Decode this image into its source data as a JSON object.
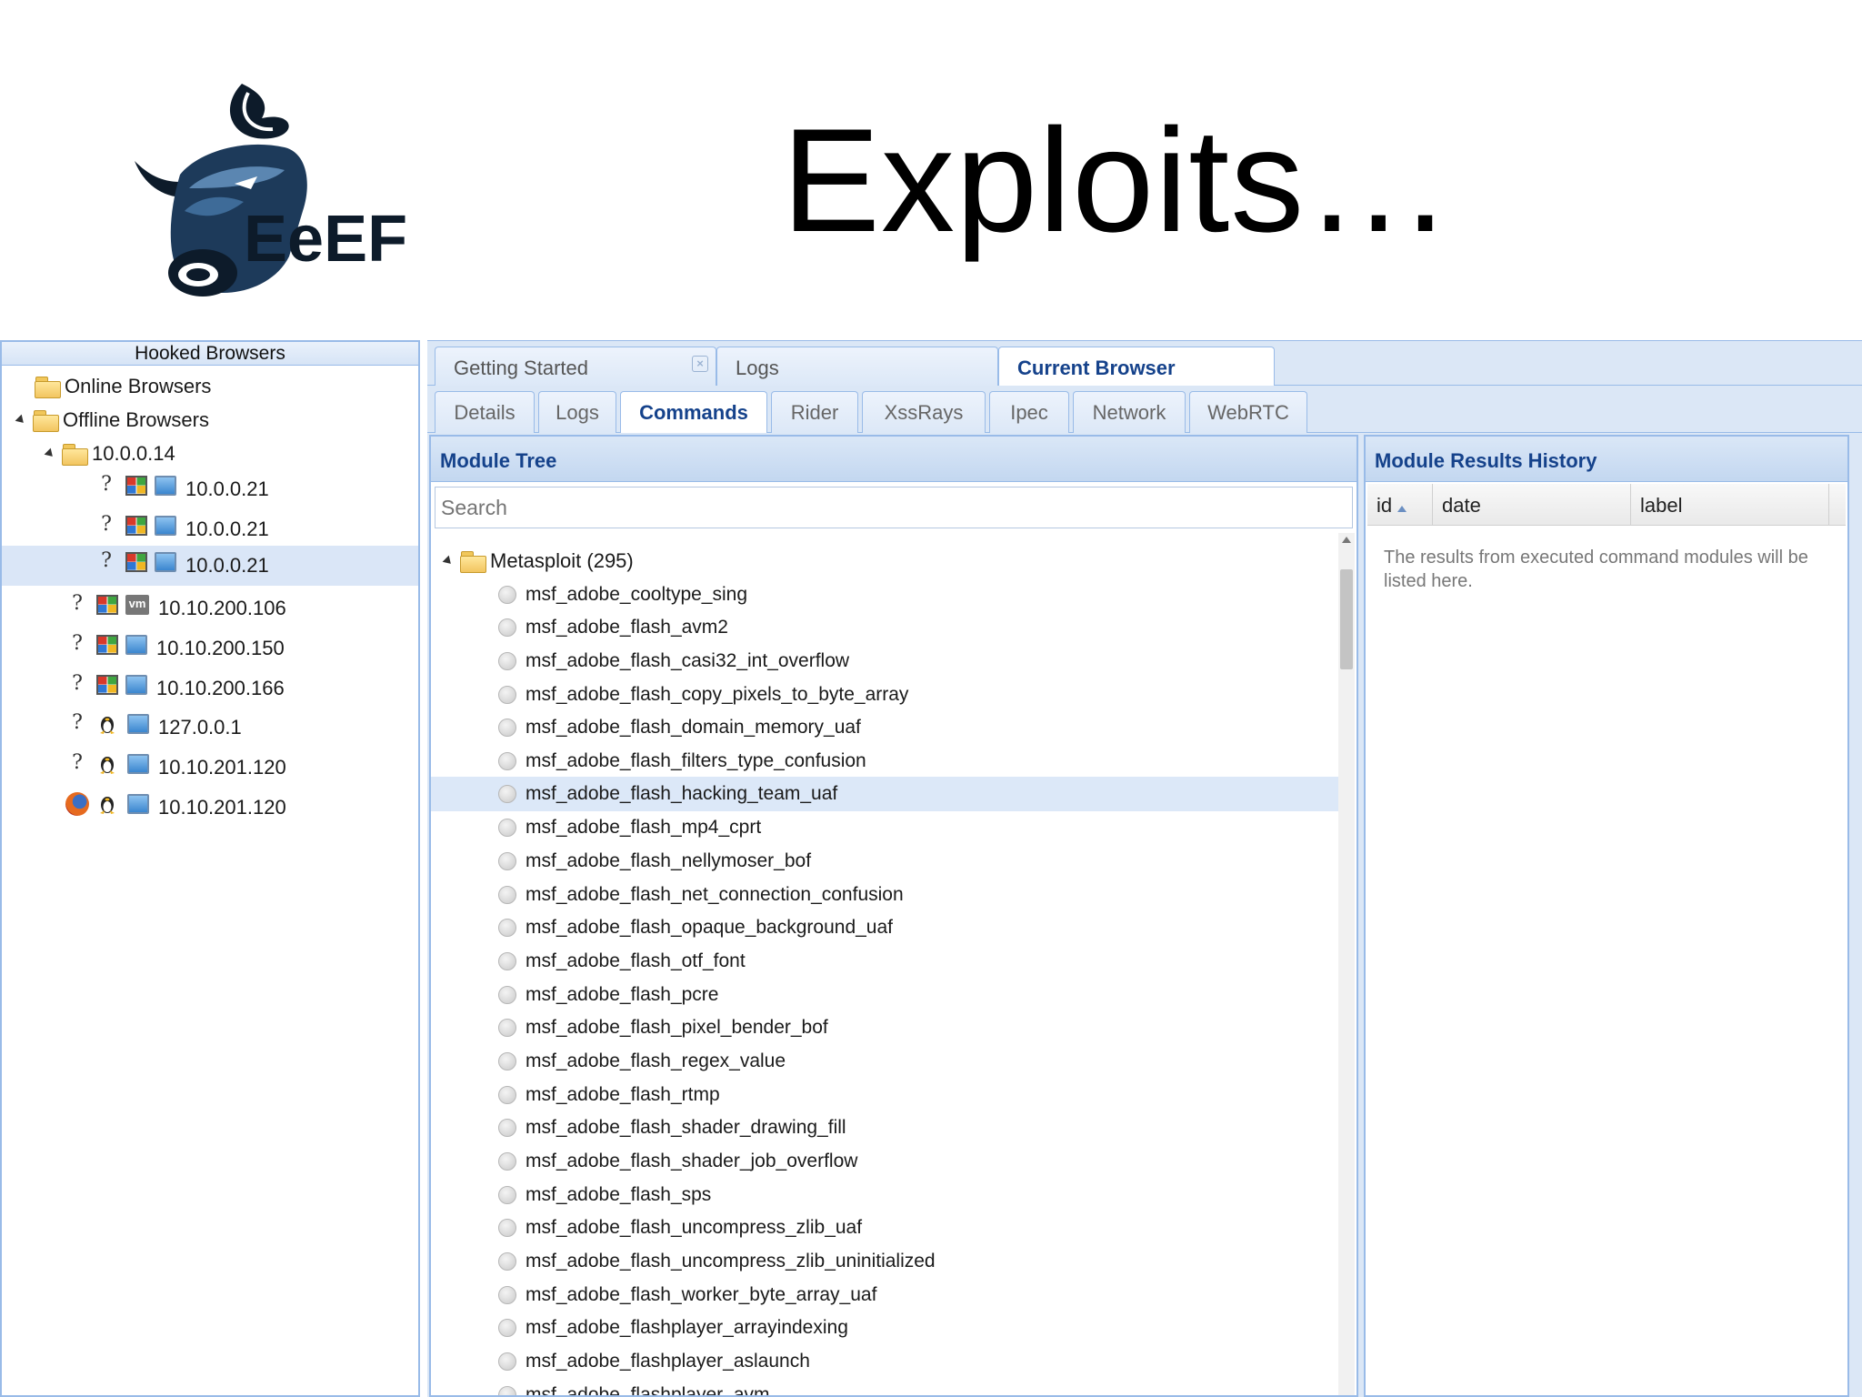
{
  "slide": {
    "title": "Exploits…",
    "logo_text": "EeEF"
  },
  "left_panel": {
    "header": "Hooked Browsers",
    "online_label": "Online Browsers",
    "offline_label": "Offline Browsers",
    "group_label": "10.0.0.14",
    "group_items": [
      {
        "ip": "10.0.0.21",
        "os": "windows",
        "type": "desktop"
      },
      {
        "ip": "10.0.0.21",
        "os": "windows",
        "type": "desktop"
      },
      {
        "ip": "10.0.0.21",
        "os": "windows",
        "type": "desktop",
        "selected": true
      }
    ],
    "items": [
      {
        "ip": "10.10.200.106",
        "browser": "unknown",
        "os": "windows",
        "type": "vm"
      },
      {
        "ip": "10.10.200.150",
        "browser": "unknown",
        "os": "windows",
        "type": "desktop"
      },
      {
        "ip": "10.10.200.166",
        "browser": "unknown",
        "os": "windows",
        "type": "desktop"
      },
      {
        "ip": "127.0.0.1",
        "browser": "unknown",
        "os": "linux",
        "type": "desktop"
      },
      {
        "ip": "10.10.201.120",
        "browser": "unknown",
        "os": "linux",
        "type": "desktop"
      },
      {
        "ip": "10.10.201.120",
        "browser": "firefox",
        "os": "linux",
        "type": "desktop"
      }
    ],
    "unknown_browser_glyph": "?"
  },
  "main_tabs": [
    {
      "label": "Getting Started",
      "closable": true
    },
    {
      "label": "Logs"
    },
    {
      "label": "Current Browser",
      "active": true
    }
  ],
  "close_glyph": "×",
  "sub_tabs": [
    {
      "label": "Details"
    },
    {
      "label": "Logs"
    },
    {
      "label": "Commands",
      "active": true
    },
    {
      "label": "Rider"
    },
    {
      "label": "XssRays"
    },
    {
      "label": "Ipec"
    },
    {
      "label": "Network"
    },
    {
      "label": "WebRTC"
    }
  ],
  "module_tree": {
    "title": "Module Tree",
    "search_placeholder": "Search",
    "root_label": "Metasploit (295)",
    "modules": [
      "msf_adobe_cooltype_sing",
      "msf_adobe_flash_avm2",
      "msf_adobe_flash_casi32_int_overflow",
      "msf_adobe_flash_copy_pixels_to_byte_array",
      "msf_adobe_flash_domain_memory_uaf",
      "msf_adobe_flash_filters_type_confusion",
      "msf_adobe_flash_hacking_team_uaf",
      "msf_adobe_flash_mp4_cprt",
      "msf_adobe_flash_nellymoser_bof",
      "msf_adobe_flash_net_connection_confusion",
      "msf_adobe_flash_opaque_background_uaf",
      "msf_adobe_flash_otf_font",
      "msf_adobe_flash_pcre",
      "msf_adobe_flash_pixel_bender_bof",
      "msf_adobe_flash_regex_value",
      "msf_adobe_flash_rtmp",
      "msf_adobe_flash_shader_drawing_fill",
      "msf_adobe_flash_shader_job_overflow",
      "msf_adobe_flash_sps",
      "msf_adobe_flash_uncompress_zlib_uaf",
      "msf_adobe_flash_uncompress_zlib_uninitialized",
      "msf_adobe_flash_worker_byte_array_uaf",
      "msf_adobe_flashplayer_arrayindexing",
      "msf_adobe_flashplayer_aslaunch",
      "msf_adobe_flashplayer_avm"
    ],
    "selected_module": "msf_adobe_flash_hacking_team_uaf"
  },
  "results": {
    "title": "Module Results History",
    "columns": [
      "id",
      "date",
      "label"
    ],
    "empty_message": "The results from executed command modules will be listed here."
  },
  "colors": {
    "accent": "#15428b",
    "border": "#99bbe8",
    "selection": "#dae6f7"
  }
}
